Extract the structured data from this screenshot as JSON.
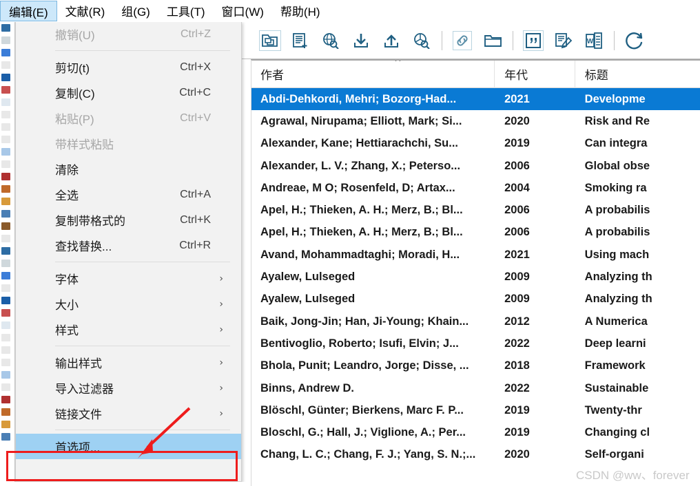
{
  "menubar": {
    "items": [
      {
        "label": "编辑(E)",
        "active": true
      },
      {
        "label": "文献(R)",
        "active": false
      },
      {
        "label": "组(G)",
        "active": false
      },
      {
        "label": "工具(T)",
        "active": false
      },
      {
        "label": "窗口(W)",
        "active": false
      },
      {
        "label": "帮助(H)",
        "active": false
      }
    ]
  },
  "toolbar": {
    "buttons": [
      {
        "icon": "copy-folder-icon",
        "framed": true
      },
      {
        "icon": "new-reference-icon",
        "framed": false
      },
      {
        "icon": "online-search-globe-icon",
        "framed": false
      },
      {
        "icon": "import-download-icon",
        "framed": false
      },
      {
        "icon": "export-upload-icon",
        "framed": false
      },
      {
        "icon": "find-pdf-icon",
        "framed": false
      },
      {
        "icon": "link-icon",
        "framed": true
      },
      {
        "icon": "open-folder-icon",
        "framed": false
      },
      {
        "icon": "quote-icon",
        "framed": true
      },
      {
        "icon": "edit-document-icon",
        "framed": false
      },
      {
        "icon": "word-icon",
        "framed": false
      },
      {
        "icon": "sync-refresh-icon",
        "framed": false
      }
    ]
  },
  "edit_menu": {
    "items": [
      {
        "label": "撤销(U)",
        "accel": "Ctrl+Z",
        "disabled": true,
        "submenu": false,
        "highlight": false,
        "sep_after": true
      },
      {
        "label": "剪切(t)",
        "accel": "Ctrl+X",
        "disabled": false,
        "submenu": false,
        "highlight": false,
        "sep_after": false
      },
      {
        "label": "复制(C)",
        "accel": "Ctrl+C",
        "disabled": false,
        "submenu": false,
        "highlight": false,
        "sep_after": false
      },
      {
        "label": "粘贴(P)",
        "accel": "Ctrl+V",
        "disabled": true,
        "submenu": false,
        "highlight": false,
        "sep_after": false
      },
      {
        "label": "带样式粘贴",
        "accel": "",
        "disabled": true,
        "submenu": false,
        "highlight": false,
        "sep_after": false
      },
      {
        "label": "清除",
        "accel": "",
        "disabled": false,
        "submenu": false,
        "highlight": false,
        "sep_after": false
      },
      {
        "label": "全选",
        "accel": "Ctrl+A",
        "disabled": false,
        "submenu": false,
        "highlight": false,
        "sep_after": false
      },
      {
        "label": "复制带格式的",
        "accel": "Ctrl+K",
        "disabled": false,
        "submenu": false,
        "highlight": false,
        "sep_after": false
      },
      {
        "label": "查找替换...",
        "accel": "Ctrl+R",
        "disabled": false,
        "submenu": false,
        "highlight": false,
        "sep_after": true
      },
      {
        "label": "字体",
        "accel": "",
        "disabled": false,
        "submenu": true,
        "highlight": false,
        "sep_after": false
      },
      {
        "label": "大小",
        "accel": "",
        "disabled": false,
        "submenu": true,
        "highlight": false,
        "sep_after": false
      },
      {
        "label": "样式",
        "accel": "",
        "disabled": false,
        "submenu": true,
        "highlight": false,
        "sep_after": true
      },
      {
        "label": "输出样式",
        "accel": "",
        "disabled": false,
        "submenu": true,
        "highlight": false,
        "sep_after": false
      },
      {
        "label": "导入过滤器",
        "accel": "",
        "disabled": false,
        "submenu": true,
        "highlight": false,
        "sep_after": false
      },
      {
        "label": "链接文件",
        "accel": "",
        "disabled": false,
        "submenu": true,
        "highlight": false,
        "sep_after": true
      },
      {
        "label": "首选项...",
        "accel": "",
        "disabled": false,
        "submenu": false,
        "highlight": true,
        "sep_after": false
      }
    ]
  },
  "table": {
    "sort_indicator": "ascending-caret",
    "columns": [
      {
        "key": "author",
        "label": "作者"
      },
      {
        "key": "year",
        "label": "年代"
      },
      {
        "key": "title",
        "label": "标题"
      }
    ],
    "rows": [
      {
        "author": "Abdi-Dehkordi, Mehri; Bozorg-Had...",
        "year": "2021",
        "title": "Developme",
        "selected": true
      },
      {
        "author": "Agrawal, Nirupama; Elliott, Mark; Si...",
        "year": "2020",
        "title": "Risk and Re",
        "selected": false
      },
      {
        "author": "Alexander, Kane; Hettiarachchi, Su...",
        "year": "2019",
        "title": "Can integra",
        "selected": false
      },
      {
        "author": "Alexander, L. V.; Zhang, X.; Peterso...",
        "year": "2006",
        "title": "Global obse",
        "selected": false
      },
      {
        "author": "Andreae, M O; Rosenfeld, D; Artax...",
        "year": "2004",
        "title": "Smoking ra",
        "selected": false
      },
      {
        "author": "Apel, H.; Thieken, A. H.; Merz, B.; Bl...",
        "year": "2006",
        "title": "A probabilis",
        "selected": false
      },
      {
        "author": "Apel, H.; Thieken, A. H.; Merz, B.; Bl...",
        "year": "2006",
        "title": "A probabilis",
        "selected": false
      },
      {
        "author": "Avand, Mohammadtaghi; Moradi, H...",
        "year": "2021",
        "title": "Using mach",
        "selected": false
      },
      {
        "author": "Ayalew, Lulseged",
        "year": "2009",
        "title": "Analyzing th",
        "selected": false
      },
      {
        "author": "Ayalew, Lulseged",
        "year": "2009",
        "title": "Analyzing th",
        "selected": false
      },
      {
        "author": "Baik, Jong-Jin; Han, Ji-Young; Khain...",
        "year": "2012",
        "title": "A Numerica",
        "selected": false
      },
      {
        "author": "Bentivoglio, Roberto; Isufi, Elvin; J...",
        "year": "2022",
        "title": "Deep learni",
        "selected": false
      },
      {
        "author": "Bhola, Punit; Leandro, Jorge; Disse, ...",
        "year": "2018",
        "title": "Framework",
        "selected": false
      },
      {
        "author": "Binns, Andrew D.",
        "year": "2022",
        "title": "Sustainable",
        "selected": false
      },
      {
        "author": "Blöschl, Günter; Bierkens, Marc F. P...",
        "year": "2019",
        "title": "Twenty-thr",
        "selected": false
      },
      {
        "author": "Bloschl, G.; Hall, J.; Viglione, A.; Per...",
        "year": "2019",
        "title": "Changing cl",
        "selected": false
      },
      {
        "author": "Chang, L. C.; Chang, F. J.; Yang, S. N.;...",
        "year": "2020",
        "title": "Self-organi",
        "selected": false
      }
    ]
  },
  "annotation": {
    "box_color": "#ee1c1c",
    "arrow_color": "#ee1c1c",
    "target": "首选项..."
  },
  "watermark": {
    "text": "CSDN @ww、forever",
    "color": "#c9c9c9"
  },
  "colors": {
    "selected_row": "#0a7ad4",
    "menu_highlight": "#9ed1f3",
    "menubar_active": "#cde8fa",
    "icon_stroke": "#1f5f82"
  }
}
